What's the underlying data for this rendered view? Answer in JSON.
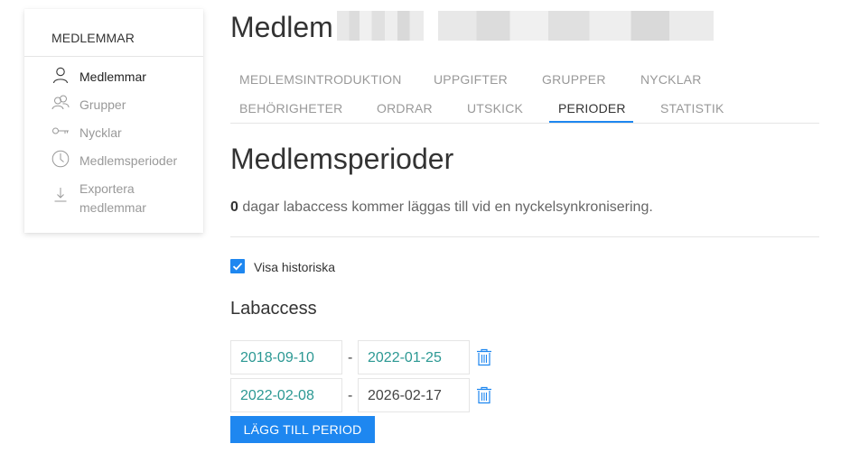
{
  "sidebar": {
    "title": "MEDLEMMAR",
    "items": [
      {
        "label": "Medlemmar",
        "icon": "user-icon"
      },
      {
        "label": "Grupper",
        "icon": "users-icon"
      },
      {
        "label": "Nycklar",
        "icon": "key-icon"
      },
      {
        "label": "Medlemsperioder",
        "icon": "clock-icon"
      },
      {
        "label_line1": "Exportera",
        "label_line2": "medlemmar",
        "icon": "download-icon"
      }
    ]
  },
  "header": {
    "title": "Medlem"
  },
  "tabs": [
    {
      "label": "MEDLEMSINTRODUKTION"
    },
    {
      "label": "UPPGIFTER"
    },
    {
      "label": "GRUPPER"
    },
    {
      "label": "NYCKLAR"
    },
    {
      "label": "BEHÖRIGHETER"
    },
    {
      "label": "ORDRAR"
    },
    {
      "label": "UTSKICK"
    },
    {
      "label": "PERIODER"
    },
    {
      "label": "STATISTIK"
    }
  ],
  "main": {
    "title": "Medlemsperioder",
    "info_count": "0",
    "info_text": "dagar labaccess kommer läggas till vid en nyckelsynkronisering.",
    "show_history_label": "Visa historiska",
    "labaccess_title": "Labaccess",
    "periods": [
      {
        "start": "2018-09-10",
        "end": "2022-01-25"
      },
      {
        "start": "2022-02-08",
        "end": "2026-02-17"
      }
    ],
    "dash": "-",
    "add_button": "LÄGG TILL PERIOD"
  },
  "colors": {
    "accent": "#1e87f0",
    "date_text": "#2b9893",
    "muted": "#999999"
  }
}
